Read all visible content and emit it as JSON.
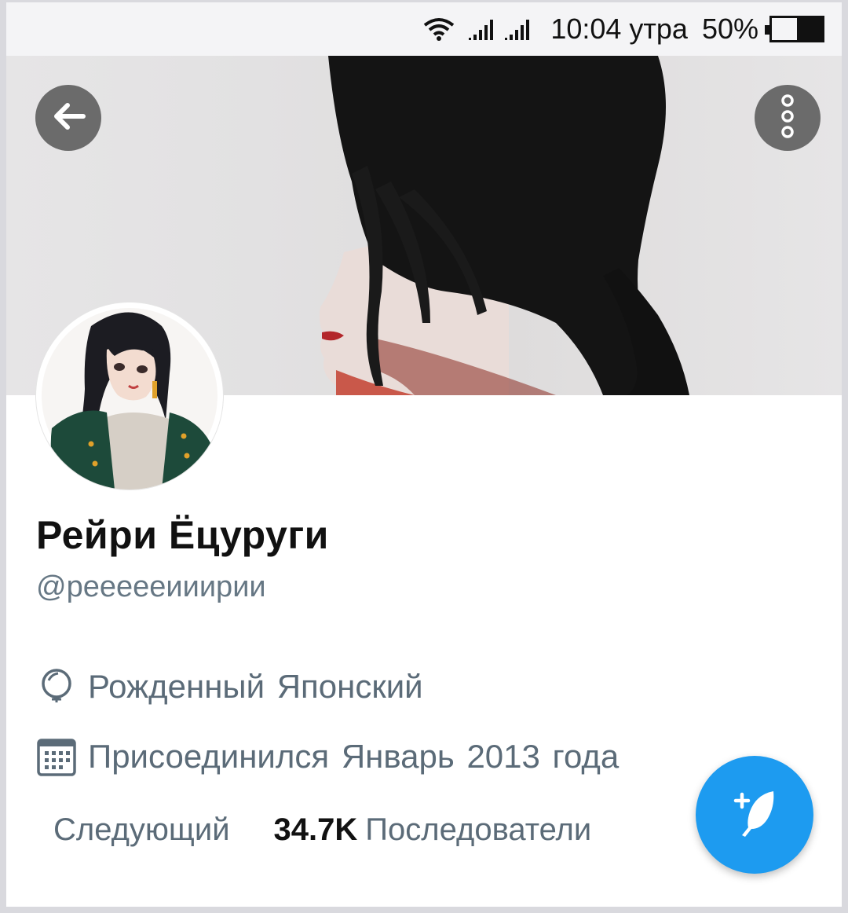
{
  "status_bar": {
    "time": "10:04 утра",
    "battery": "50%",
    "battery_level": 0.5,
    "icons": [
      "wifi-icon",
      "signal-icon",
      "signal-icon",
      "battery-icon"
    ]
  },
  "toolbar": {
    "back_icon": "arrow-left-icon",
    "more_icon": "more-vertical-icon"
  },
  "profile": {
    "name": "Рейри Ёцуруги",
    "handle": "@реееееииирии",
    "location": "Рожденный Японский",
    "joined": "Присоединился Январь 2013 года",
    "following_label": "Следующий",
    "followers_count": "34.7K",
    "followers_label": "Последователи"
  },
  "fab": {
    "icon": "compose-tweet-icon"
  },
  "colors": {
    "accent": "#1d9bf0",
    "secondary_text": "#5b6b78"
  }
}
